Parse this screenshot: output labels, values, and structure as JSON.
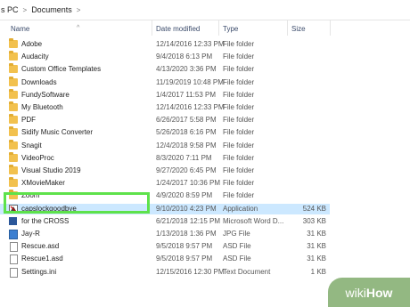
{
  "breadcrumb": {
    "pc": "s PC",
    "sep": ">",
    "folder": "Documents",
    "sep2": ">"
  },
  "columns": {
    "name": "Name",
    "date": "Date modified",
    "type": "Type",
    "size": "Size"
  },
  "rows": [
    {
      "name": "Adobe",
      "date": "12/14/2016 12:33 PM",
      "type": "File folder",
      "size": "",
      "icon": "folder"
    },
    {
      "name": "Audacity",
      "date": "9/4/2018 6:13 PM",
      "type": "File folder",
      "size": "",
      "icon": "folder"
    },
    {
      "name": "Custom Office Templates",
      "date": "4/13/2020 3:36 PM",
      "type": "File folder",
      "size": "",
      "icon": "folder"
    },
    {
      "name": "Downloads",
      "date": "11/19/2019 10:48 PM",
      "type": "File folder",
      "size": "",
      "icon": "folder"
    },
    {
      "name": "FundySoftware",
      "date": "1/4/2017 11:53 PM",
      "type": "File folder",
      "size": "",
      "icon": "folder"
    },
    {
      "name": "My Bluetooth",
      "date": "12/14/2016 12:33 PM",
      "type": "File folder",
      "size": "",
      "icon": "folder"
    },
    {
      "name": "PDF",
      "date": "6/26/2017 5:58 PM",
      "type": "File folder",
      "size": "",
      "icon": "folder"
    },
    {
      "name": "Sidify Music Converter",
      "date": "5/26/2018 6:16 PM",
      "type": "File folder",
      "size": "",
      "icon": "folder"
    },
    {
      "name": "Snagit",
      "date": "12/4/2018 9:58 PM",
      "type": "File folder",
      "size": "",
      "icon": "folder"
    },
    {
      "name": "VideoProc",
      "date": "8/3/2020 7:11 PM",
      "type": "File folder",
      "size": "",
      "icon": "folder"
    },
    {
      "name": "Visual Studio 2019",
      "date": "9/27/2020 6:45 PM",
      "type": "File folder",
      "size": "",
      "icon": "folder"
    },
    {
      "name": "XMovieMaker",
      "date": "1/24/2017 10:36 PM",
      "type": "File folder",
      "size": "",
      "icon": "folder"
    },
    {
      "name": "Zoom",
      "date": "4/9/2020 8:59 PM",
      "type": "File folder",
      "size": "",
      "icon": "folder"
    },
    {
      "name": "capslockgoodbye",
      "date": "9/10/2010 4:23 PM",
      "type": "Application",
      "size": "524 KB",
      "icon": "app"
    },
    {
      "name": "for the CROSS",
      "date": "6/21/2018 12:15 PM",
      "type": "Microsoft Word D...",
      "size": "303 KB",
      "icon": "word"
    },
    {
      "name": "Jay-R",
      "date": "1/13/2018 1:36 PM",
      "type": "JPG File",
      "size": "31 KB",
      "icon": "jpg"
    },
    {
      "name": "Rescue.asd",
      "date": "9/5/2018 9:57 PM",
      "type": "ASD File",
      "size": "31 KB",
      "icon": "doc"
    },
    {
      "name": "Rescue1.asd",
      "date": "9/5/2018 9:57 PM",
      "type": "ASD File",
      "size": "31 KB",
      "icon": "doc"
    },
    {
      "name": "Settings.ini",
      "date": "12/15/2016 12:30 PM",
      "type": "Text Document",
      "size": "1 KB",
      "icon": "doc"
    }
  ],
  "watermark": {
    "wiki": "wiki",
    "how": "How"
  },
  "colors": {
    "highlight": "#5ee24b",
    "selected_row": "#cce8ff",
    "folder": "#f2c14e"
  }
}
